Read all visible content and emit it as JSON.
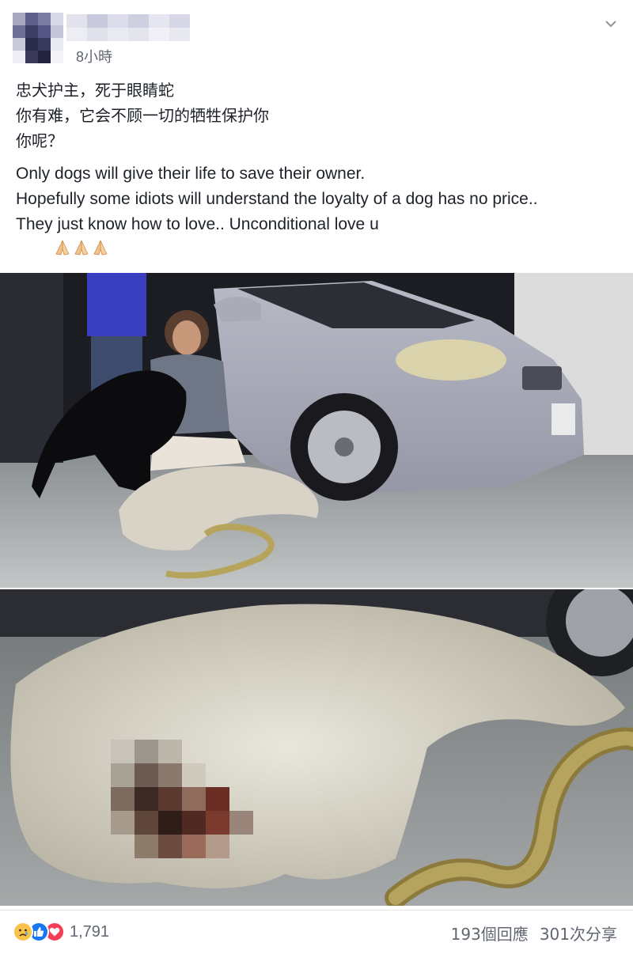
{
  "post": {
    "timestamp": "8小時",
    "text_cn": [
      "忠犬护主，死于眼睛蛇",
      "你有难，它会不顾一切的牺牲保护你",
      "你呢？"
    ],
    "text_en": [
      "Only dogs will give their life to save their owner.",
      "Hopefully some idiots will understand the loyalty of a dog has no price..",
      "They just know how to love.. Unconditional love u"
    ],
    "emoji": [
      "folded-hands",
      "folded-hands",
      "folded-hands"
    ]
  },
  "reactions": {
    "icons": [
      "sad-reaction-icon",
      "like-reaction-icon",
      "love-reaction-icon"
    ],
    "count": "1,791"
  },
  "stats": {
    "comments": "193個回應",
    "shares": "301次分享"
  },
  "colors": {
    "like": "#1877f2",
    "love": "#f33e58",
    "sad": "#f7c34b",
    "meta_text": "#616770"
  }
}
